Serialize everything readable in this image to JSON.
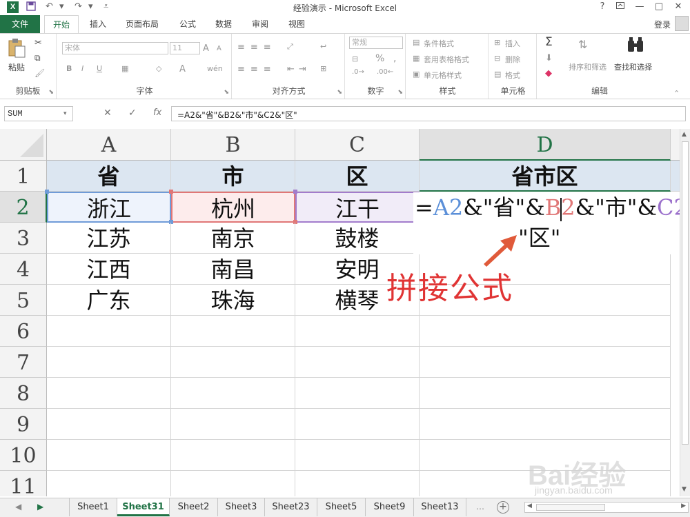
{
  "window": {
    "title": "经验演示 - Microsoft Excel",
    "logo": "X",
    "help": "?",
    "controls": [
      "restore-ribbon",
      "minimize",
      "maximize",
      "close"
    ]
  },
  "quick_access": {
    "save_icon": "save-icon",
    "undo_icon": "undo-icon",
    "redo_icon": "redo-icon"
  },
  "tabs": {
    "file": "文件",
    "items": [
      "开始",
      "插入",
      "页面布局",
      "公式",
      "数据",
      "审阅",
      "视图"
    ],
    "active": "开始",
    "login": "登录"
  },
  "ribbon": {
    "clipboard": {
      "paste": "粘贴",
      "label": "剪贴板"
    },
    "font": {
      "name": "宋体",
      "size": "11",
      "bold": "B",
      "italic": "I",
      "underline": "U",
      "grow": "A",
      "shrink": "A",
      "font_color": "A",
      "phonetic": "wén",
      "label": "字体"
    },
    "alignment": {
      "label": "对齐方式"
    },
    "number": {
      "format": "常规",
      "percent": "%",
      "comma": ",",
      "label": "数字"
    },
    "styles": {
      "conditional": "条件格式",
      "table": "套用表格格式",
      "cell": "单元格样式",
      "label": "样式"
    },
    "cells": {
      "insert": "插入",
      "delete": "删除",
      "format": "格式",
      "label": "单元格"
    },
    "editing": {
      "sort": "排序和筛选",
      "find": "查找和选择",
      "label": "编辑"
    }
  },
  "formula_bar": {
    "name_box": "SUM",
    "fx": "fx",
    "cancel": "✕",
    "enter": "✓",
    "formula": "=A2&\"省\"&B2&\"市\"&C2&\"区\""
  },
  "columns": [
    "A",
    "B",
    "C",
    "D"
  ],
  "selected_column": "D",
  "rows": [
    "1",
    "2",
    "3",
    "4",
    "5",
    "6",
    "7",
    "8",
    "9",
    "10",
    "11"
  ],
  "selected_row": "2",
  "cells": {
    "header": [
      "省",
      "市",
      "区",
      "省市区"
    ],
    "data": [
      [
        "浙江",
        "杭州",
        "江干"
      ],
      [
        "江苏",
        "南京",
        "鼓楼"
      ],
      [
        "江西",
        "南昌",
        "安明"
      ],
      [
        "广东",
        "珠海",
        "横琴"
      ]
    ]
  },
  "edit_display": {
    "eq": "=",
    "ref_a": "A2",
    "part1": "&\"省\"&",
    "ref_b1": "B",
    "ref_b2": "2",
    "part2": "&\"市\"&",
    "ref_c": "C2",
    "part3": "&",
    "line2": "\"区\""
  },
  "annotation": "拼接公式",
  "watermark": {
    "main": "Bai经验",
    "sub": "jingyan.baidu.com"
  },
  "sheets": [
    "Sheet1",
    "Sheet31",
    "Sheet2",
    "Sheet3",
    "Sheet23",
    "Sheet5",
    "Sheet9",
    "Sheet13"
  ],
  "active_sheet": "Sheet31",
  "add_sheet": "+",
  "colors": {
    "excel_green": "#217346",
    "ref_a": "#6f9bd8",
    "ref_b": "#e07777",
    "ref_c": "#a27ccc",
    "annotation": "#e03434",
    "header_fill": "#dce6f1"
  }
}
